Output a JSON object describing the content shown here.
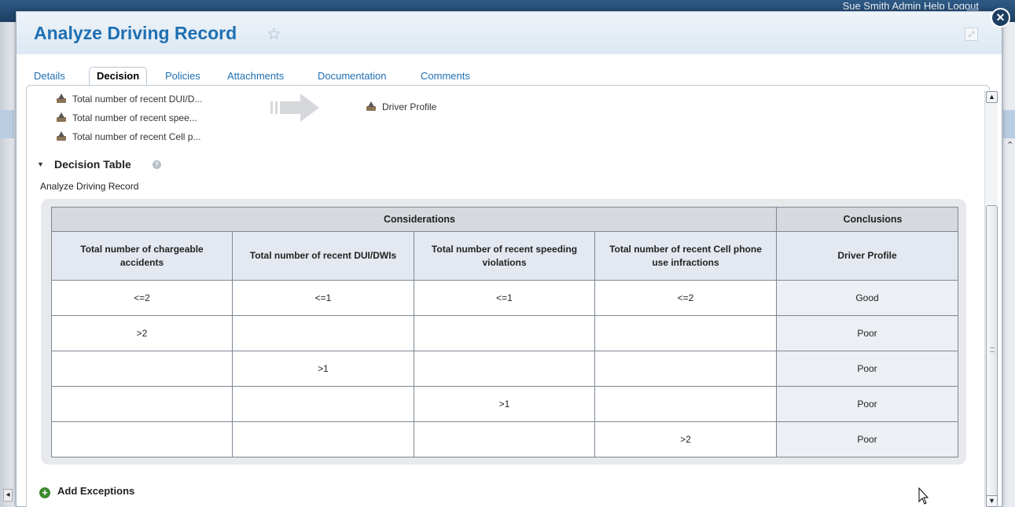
{
  "background": {
    "user_bar_text": "Sue Smith    Admin  Help  Logout"
  },
  "modal": {
    "title": "Analyze Driving Record",
    "tabs": [
      {
        "label": "Details"
      },
      {
        "label": "Decision",
        "active": true
      },
      {
        "label": "Policies"
      },
      {
        "label": "Attachments"
      },
      {
        "label": "Documentation"
      },
      {
        "label": "Comments"
      }
    ]
  },
  "flow": {
    "inputs": [
      {
        "label": "Total number of recent DUI/D..."
      },
      {
        "label": "Total number of recent spee..."
      },
      {
        "label": "Total number of recent Cell p..."
      }
    ],
    "output": {
      "label": "Driver Profile"
    }
  },
  "decision_table": {
    "section_title": "Decision Table",
    "caption": "Analyze Driving Record",
    "group_considerations": "Considerations",
    "group_conclusions": "Conclusions",
    "columns": [
      "Total number of chargeable accidents",
      "Total number of recent DUI/DWIs",
      "Total number of recent speeding violations",
      "Total number of recent Cell phone use infractions",
      "Driver Profile"
    ],
    "rows": [
      [
        "<=2",
        "<=1",
        "<=1",
        "<=2",
        "Good"
      ],
      [
        ">2",
        "",
        "",
        "",
        "Poor"
      ],
      [
        "",
        ">1",
        "",
        "",
        "Poor"
      ],
      [
        "",
        "",
        ">1",
        "",
        "Poor"
      ],
      [
        "",
        "",
        "",
        ">2",
        "Poor"
      ]
    ]
  },
  "actions": {
    "add_exceptions": "Add Exceptions"
  },
  "icons": {
    "star": "star-outline-icon",
    "close": "close-icon",
    "maximize": "maximize-icon",
    "upload": "upload-icon",
    "info": "info-icon",
    "plus": "plus-icon"
  },
  "colors": {
    "title": "#1f6fb2",
    "header_bg": "#e4e9f1",
    "add_green": "#3d8a2f"
  }
}
